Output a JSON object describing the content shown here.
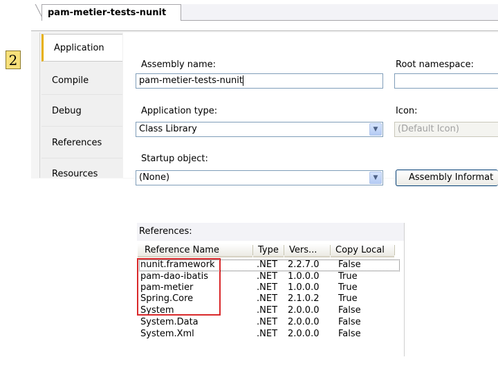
{
  "document_tab": {
    "title": "pam-metier-tests-nunit"
  },
  "step_badge": "2",
  "side_tabs": [
    {
      "label": "Application",
      "active": true
    },
    {
      "label": "Compile",
      "active": false
    },
    {
      "label": "Debug",
      "active": false
    },
    {
      "label": "References",
      "active": false
    },
    {
      "label": "Resources",
      "active": false
    }
  ],
  "application": {
    "assembly_name_label": "Assembly name:",
    "assembly_name_value": "pam-metier-tests-nunit",
    "root_namespace_label": "Root namespace:",
    "root_namespace_value": "",
    "application_type_label": "Application type:",
    "application_type_value": "Class Library",
    "icon_label": "Icon:",
    "icon_value": "(Default Icon)",
    "startup_object_label": "Startup object:",
    "startup_object_value": "(None)",
    "assembly_info_button": "Assembly Informat"
  },
  "references": {
    "title": "References:",
    "columns": [
      "Reference Name",
      "Type",
      "Vers...",
      "Copy Local"
    ],
    "rows": [
      {
        "name": "nunit.framework",
        "type": ".NET",
        "version": "2.2.7.0",
        "copy_local": "False"
      },
      {
        "name": "pam-dao-ibatis",
        "type": ".NET",
        "version": "1.0.0.0",
        "copy_local": "True"
      },
      {
        "name": "pam-metier",
        "type": ".NET",
        "version": "1.0.0.0",
        "copy_local": "True"
      },
      {
        "name": "Spring.Core",
        "type": ".NET",
        "version": "2.1.0.2",
        "copy_local": "True"
      },
      {
        "name": "System",
        "type": ".NET",
        "version": "2.0.0.0",
        "copy_local": "False"
      },
      {
        "name": "System.Data",
        "type": ".NET",
        "version": "2.0.0.0",
        "copy_local": "False"
      },
      {
        "name": "System.Xml",
        "type": ".NET",
        "version": "2.0.0.0",
        "copy_local": "False"
      }
    ]
  },
  "colors": {
    "highlight": "#d9282a",
    "active_tab_accent": "#e6b000",
    "badge": "#f7e07a"
  }
}
